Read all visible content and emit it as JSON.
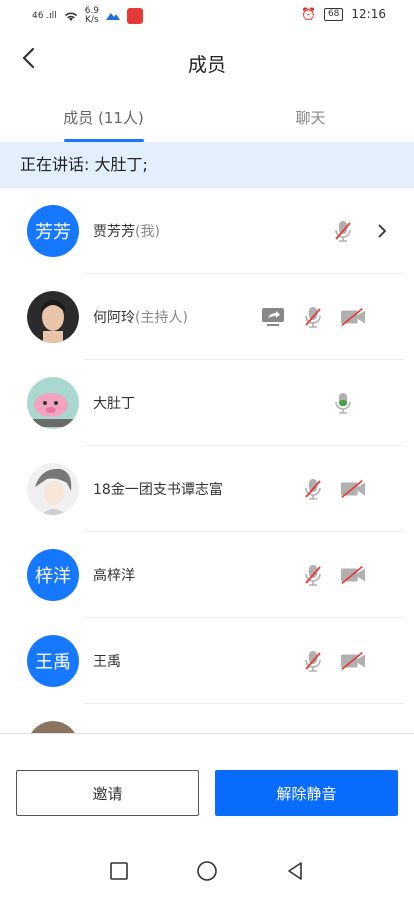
{
  "status_bar": {
    "signal": "46 .ıll",
    "speed_value": "6.9",
    "speed_unit": "K/s",
    "battery": "68",
    "time": "12:16"
  },
  "header": {
    "title": "成员"
  },
  "tabs": [
    {
      "label": "成员 (11人)",
      "active": true
    },
    {
      "label": "聊天",
      "active": false
    }
  ],
  "speaking": "正在讲话: 大肚丁;",
  "members": [
    {
      "avatar_text": "芳芳",
      "name": "贾芳芳",
      "role": "(我)"
    },
    {
      "avatar_text": "",
      "name": "何阿玲",
      "role": "(主持人)"
    },
    {
      "avatar_text": "",
      "name": "大肚丁",
      "role": ""
    },
    {
      "avatar_text": "",
      "name": "18金一团支书谭志富",
      "role": ""
    },
    {
      "avatar_text": "梓洋",
      "name": "高梓洋",
      "role": ""
    },
    {
      "avatar_text": "王禹",
      "name": "王禹",
      "role": ""
    }
  ],
  "buttons": {
    "invite": "邀请",
    "unmute": "解除静音"
  },
  "colors": {
    "accent": "#0a6cff",
    "mic_active": "#43a047",
    "muted_red": "#e53935"
  }
}
